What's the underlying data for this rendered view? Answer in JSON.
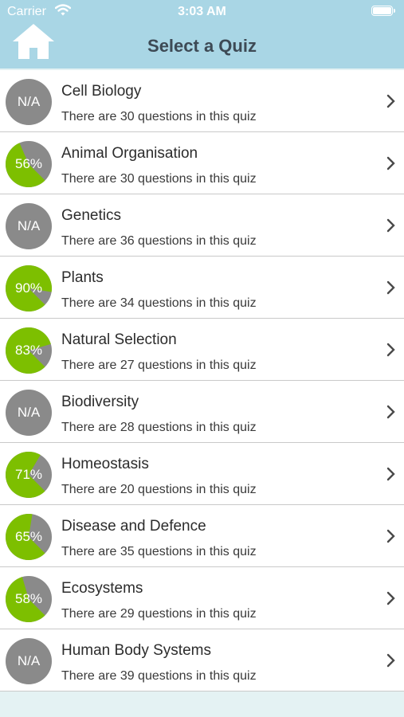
{
  "status_bar": {
    "carrier": "Carrier",
    "time": "3:03 AM"
  },
  "header": {
    "title": "Select a Quiz",
    "home_icon": "home-icon",
    "background_color": "#a9d6e5"
  },
  "colors": {
    "score_fill": "#7dbf00",
    "score_base": "#8a8a8a"
  },
  "quizzes": [
    {
      "title": "Cell Biology",
      "subtitle": "There are 30 questions in this quiz",
      "score_label": "N/A",
      "score": null
    },
    {
      "title": "Animal Organisation",
      "subtitle": "There are 30 questions in this quiz",
      "score_label": "56%",
      "score": 56
    },
    {
      "title": "Genetics",
      "subtitle": "There are 36 questions in this quiz",
      "score_label": "N/A",
      "score": null
    },
    {
      "title": "Plants",
      "subtitle": "There are 34 questions in this quiz",
      "score_label": "90%",
      "score": 90
    },
    {
      "title": "Natural Selection",
      "subtitle": "There are 27 questions in this quiz",
      "score_label": "83%",
      "score": 83
    },
    {
      "title": "Biodiversity",
      "subtitle": "There are 28 questions in this quiz",
      "score_label": "N/A",
      "score": null
    },
    {
      "title": "Homeostasis",
      "subtitle": "There are 20 questions in this quiz",
      "score_label": "71%",
      "score": 71
    },
    {
      "title": "Disease and Defence",
      "subtitle": "There are 35 questions in this quiz",
      "score_label": "65%",
      "score": 65
    },
    {
      "title": "Ecosystems",
      "subtitle": "There are 29 questions in this quiz",
      "score_label": "58%",
      "score": 58
    },
    {
      "title": "Human Body Systems",
      "subtitle": "There are 39 questions in this quiz",
      "score_label": "N/A",
      "score": null
    }
  ]
}
